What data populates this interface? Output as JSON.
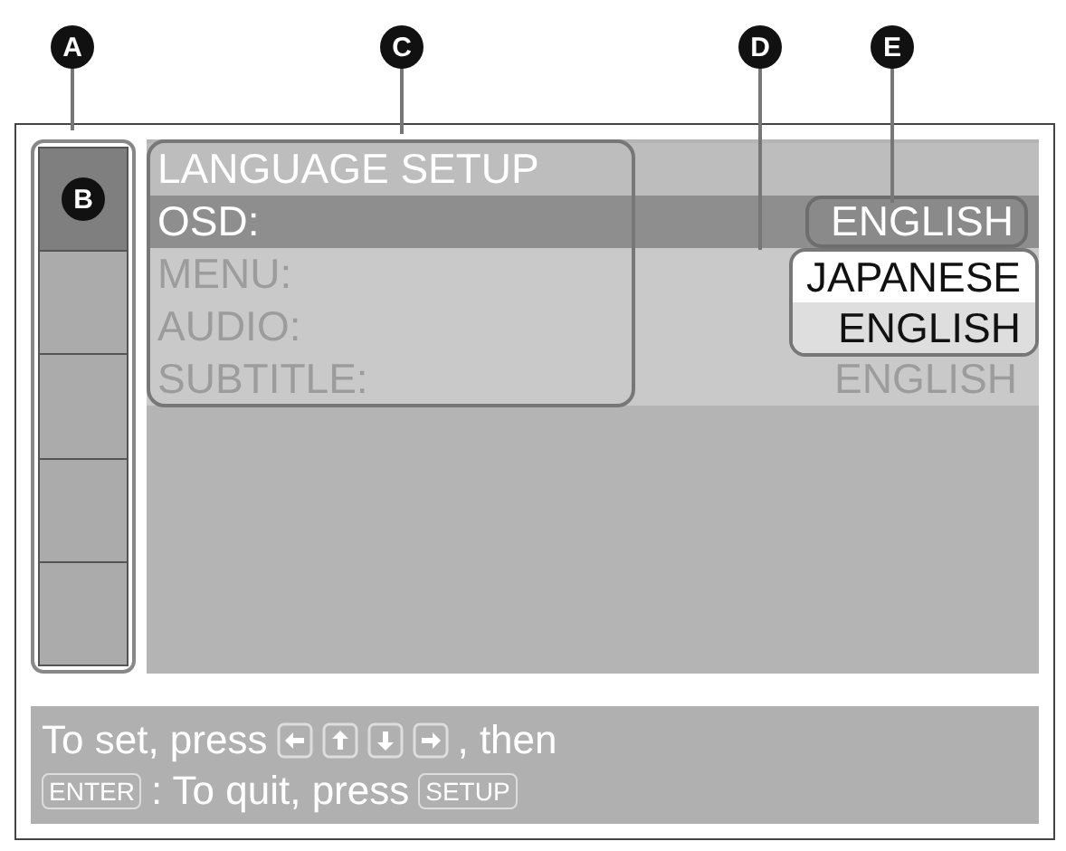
{
  "callouts": [
    {
      "label": "A"
    },
    {
      "label": "C"
    },
    {
      "label": "D"
    },
    {
      "label": "E"
    }
  ],
  "sidebar": {
    "tabs": [
      {
        "callout": "B",
        "selected": true
      },
      {
        "selected": false
      },
      {
        "selected": false
      },
      {
        "selected": false
      },
      {
        "selected": false
      }
    ]
  },
  "menu": {
    "title": "LANGUAGE SETUP",
    "rows": [
      {
        "label": "OSD:",
        "value": "ENGLISH",
        "selected": true,
        "disabled": false
      },
      {
        "label": "MENU:",
        "selected": false,
        "disabled": true
      },
      {
        "label": "AUDIO:",
        "selected": false,
        "disabled": true
      },
      {
        "label": "SUBTITLE:",
        "value": "ENGLISH",
        "selected": false,
        "disabled": true
      }
    ]
  },
  "dropdown": {
    "options": [
      {
        "label": "JAPANESE",
        "selected": false
      },
      {
        "label": "ENGLISH",
        "selected": true
      }
    ]
  },
  "help": {
    "text_1": "To set, press",
    "arrow_keys": [
      {
        "kind": "left"
      },
      {
        "kind": "up"
      },
      {
        "kind": "down"
      },
      {
        "kind": "right"
      }
    ],
    "text_2": ", then",
    "enter_key": "ENTER",
    "text_3": ": To quit, press",
    "setup_key": "SETUP"
  }
}
